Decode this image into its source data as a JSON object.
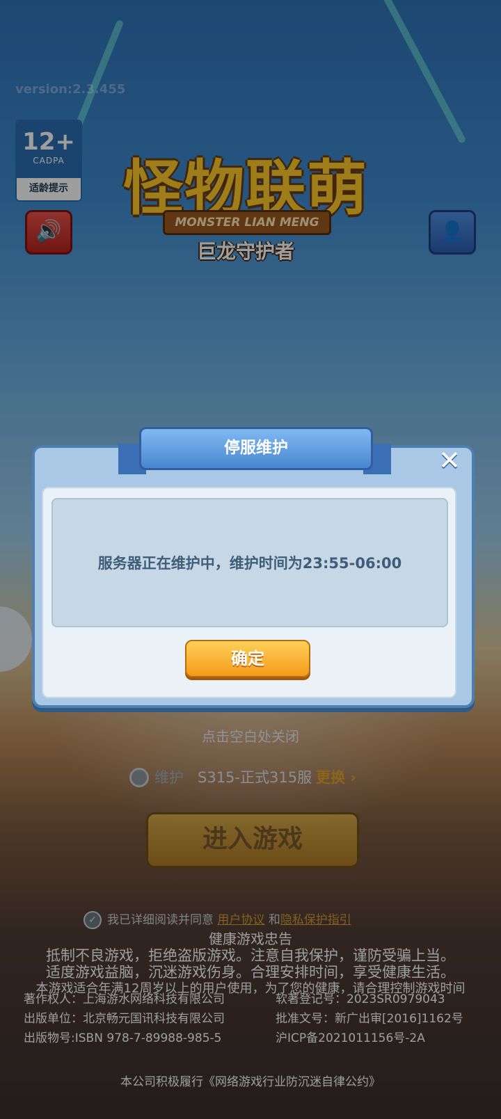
{
  "version": "version:2.3.455",
  "age_badge": {
    "rating": "12+",
    "org": "CADPA",
    "tip": "适龄提示"
  },
  "logo": {
    "title": "怪物联萌",
    "banner": "MONSTER LIAN MENG",
    "subtitle": "巨龙守护者"
  },
  "icons": {
    "sound": "speaker-icon",
    "account": "account-switch-icon",
    "close": "close-icon",
    "check": "checkmark-icon"
  },
  "dialog": {
    "title": "停服维护",
    "message": "服务器正在维护中，维护时间为23:55-06:00",
    "confirm_label": "确定"
  },
  "close_hint": "点击空白处关闭",
  "server": {
    "state": "维护",
    "name": "S315-正式315服",
    "change_label": "更换"
  },
  "enter_label": "进入游戏",
  "agreement": {
    "prefix": "我已详细阅读并同意",
    "user_agreement": "用户协议",
    "and": "和",
    "privacy": "隐私保护指引"
  },
  "health": {
    "heading": "健康游戏忠告",
    "line1": "抵制不良游戏，拒绝盗版游戏。注意自我保护，谨防受骗上当。",
    "line2": "适度游戏益脑，沉迷游戏伤身。合理安排时间，享受健康生活。",
    "age_note": "本游戏适合年满12周岁以上的用户使用，为了您的健康，请合理控制游戏时间"
  },
  "info": {
    "copyright": "著作权人：上海游水网络科技有限公司",
    "software_reg": "软著登记号：2023SR0979043",
    "publisher": "出版单位：北京畅元国讯科技有限公司",
    "approval": "批准文号：新广出审[2016]1162号",
    "isbn": "出版物号:ISBN 978-7-89988-985-5",
    "icp": "沪ICP备2021011156号-2A"
  },
  "pact": "本公司积极履行《网络游戏行业防沉迷自律公约》",
  "colors": {
    "dialog_bg": "#a9c8e6",
    "button": "#f39b1a",
    "link": "#d49b34"
  }
}
